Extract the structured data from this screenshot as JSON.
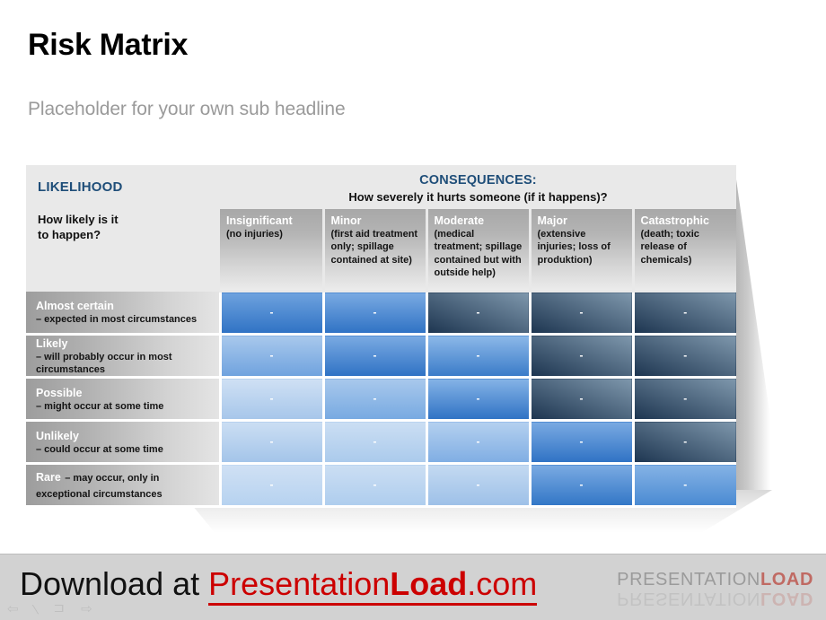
{
  "slide": {
    "title": "Risk Matrix",
    "subtitle": "Placeholder for your own sub headline"
  },
  "matrix": {
    "likelihood_header": {
      "title": "LIKELIHOOD",
      "question": "How likely is it\nto happen?",
      "question_line1": "How likely is it",
      "question_line2": "to happen?",
      "color": "#1f4e79"
    },
    "consequences_header": {
      "title": "CONSEQUENCES:",
      "subtitle": "How severely it hurts someone (if it happens)?",
      "color": "#1f4e79"
    },
    "columns": [
      {
        "name": "Insignificant",
        "desc": "(no injuries)"
      },
      {
        "name": "Minor",
        "desc": "(first aid treatment only; spillage contained at site)"
      },
      {
        "name": "Moderate",
        "desc": "(medical treatment; spillage contained but with outside help)"
      },
      {
        "name": "Major",
        "desc": "(extensive injuries; loss of produktion)"
      },
      {
        "name": "Catastrophic",
        "desc": "(death; toxic release of chemicals)"
      }
    ],
    "rows": [
      {
        "name": "Almost certain",
        "desc": "– expected in most circumstances",
        "inline": false
      },
      {
        "name": "Likely",
        "desc": "– will probably occur in most circumstances",
        "inline": false
      },
      {
        "name": "Possible",
        "desc": "– might occur at some time",
        "inline": false
      },
      {
        "name": "Unlikely",
        "desc": "– could occur at some time",
        "inline": false
      },
      {
        "name": "Rare",
        "desc": "– may occur, only in exceptional circumstances",
        "inline": true
      }
    ],
    "cell_marker": "-"
  },
  "chart_data": {
    "type": "heatmap",
    "title": "Risk Matrix",
    "xlabel": "CONSEQUENCES: How severely it hurts someone (if it happens)?",
    "ylabel": "LIKELIHOOD: How likely is it to happen?",
    "categories": [
      "Insignificant",
      "Minor",
      "Moderate",
      "Major",
      "Catastrophic"
    ],
    "rows": [
      "Almost certain",
      "Likely",
      "Possible",
      "Unlikely",
      "Rare"
    ],
    "legend": "none",
    "grid": true,
    "cells": [
      [
        {
          "level": 3,
          "top": "#6ea2de",
          "bottom": "#2f72c4"
        },
        {
          "level": 3,
          "top": "#7aaae2",
          "bottom": "#2f72c4"
        },
        {
          "level": 5,
          "top": "#7e97ac",
          "bottom": "#1d3550"
        },
        {
          "level": 5,
          "top": "#7e97ac",
          "bottom": "#1d3550"
        },
        {
          "level": 5,
          "top": "#7e97ac",
          "bottom": "#1d3550"
        }
      ],
      [
        {
          "level": 2,
          "top": "#a8c8ec",
          "bottom": "#6fa2de"
        },
        {
          "level": 3,
          "top": "#7aaae2",
          "bottom": "#2f72c4"
        },
        {
          "level": 3,
          "top": "#8cb8e8",
          "bottom": "#3a7bc8"
        },
        {
          "level": 5,
          "top": "#7e97ac",
          "bottom": "#1d3550"
        },
        {
          "level": 5,
          "top": "#7e97ac",
          "bottom": "#1d3550"
        }
      ],
      [
        {
          "level": 1,
          "top": "#cfe0f4",
          "bottom": "#a6c6ea"
        },
        {
          "level": 2,
          "top": "#a8c8ec",
          "bottom": "#77a9e1"
        },
        {
          "level": 3,
          "top": "#85b3e6",
          "bottom": "#2f72c4"
        },
        {
          "level": 5,
          "top": "#7e97ac",
          "bottom": "#1d3550"
        },
        {
          "level": 5,
          "top": "#7e97ac",
          "bottom": "#1d3550"
        }
      ],
      [
        {
          "level": 1,
          "top": "#cbdef3",
          "bottom": "#a3c4e9"
        },
        {
          "level": 1,
          "top": "#cbdef3",
          "bottom": "#aacaec"
        },
        {
          "level": 2,
          "top": "#b4d0ef",
          "bottom": "#7fadE3"
        },
        {
          "level": 3,
          "top": "#7aaae2",
          "bottom": "#2f72c4"
        },
        {
          "level": 5,
          "top": "#7e97ac",
          "bottom": "#1d3550"
        }
      ],
      [
        {
          "level": 1,
          "top": "#cfe0f4",
          "bottom": "#b6d2f0"
        },
        {
          "level": 1,
          "top": "#cbdef3",
          "bottom": "#aecdee"
        },
        {
          "level": 1,
          "top": "#c3d9f1",
          "bottom": "#9dc0e8"
        },
        {
          "level": 3,
          "top": "#7aaae2",
          "bottom": "#3276c6"
        },
        {
          "level": 3,
          "top": "#84b2e5",
          "bottom": "#4a8ad2"
        }
      ]
    ]
  },
  "footer": {
    "download_text": "Download at ",
    "brand_first": "Presentation",
    "brand_bold": "Load",
    "brand_tld": ".com",
    "logo_presentation": "PRESENTATION",
    "logo_load": "LOAD",
    "nav_glyphs": "⇦ ∕ ⊐ ⇨",
    "brand_color": "#cc0000"
  }
}
